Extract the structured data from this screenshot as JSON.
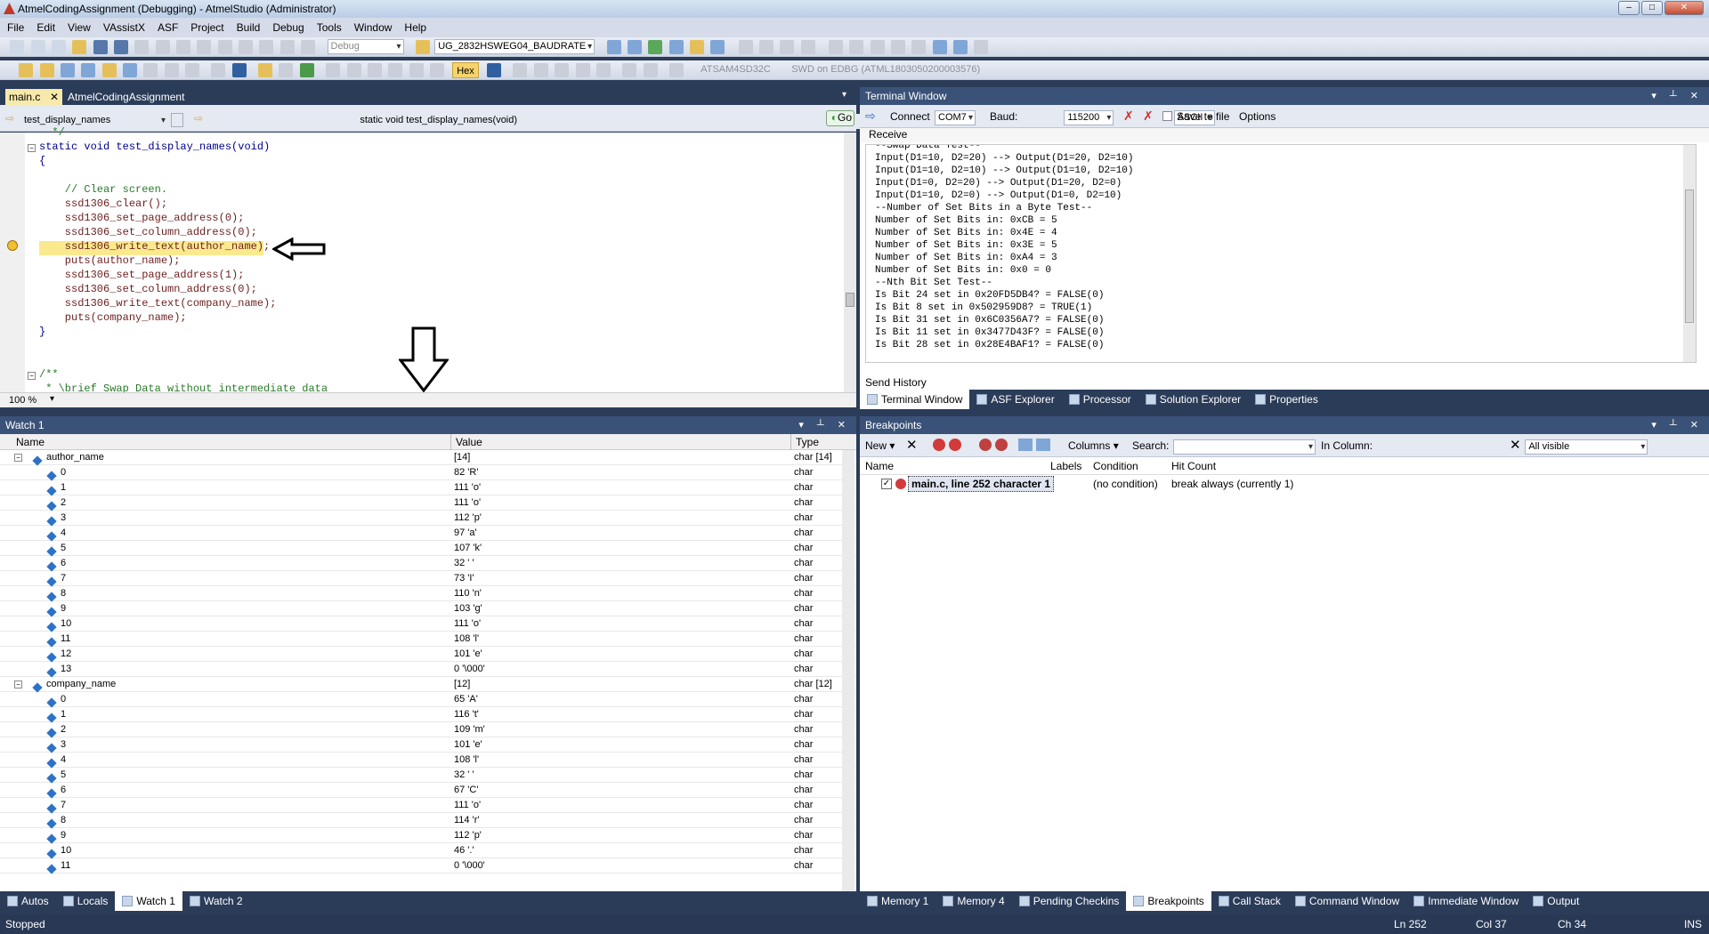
{
  "window": {
    "title": "AtmelCodingAssignment (Debugging) - AtmelStudio (Administrator)"
  },
  "menu": [
    "File",
    "Edit",
    "View",
    "VAssistX",
    "ASF",
    "Project",
    "Build",
    "Debug",
    "Tools",
    "Window",
    "Help"
  ],
  "toolbar": {
    "config": "Debug",
    "target_combo": "UG_2832HSWEG04_BAUDRATE",
    "hex_label": "Hex",
    "device": "ATSAM4SD32C",
    "tool": "SWD on EDBG (ATML1803050200003576)"
  },
  "editor": {
    "tabs": [
      "main.c",
      "AtmelCodingAssignment"
    ],
    "scope_combo": "test_display_names",
    "func_combo": "static void test_display_names(void)",
    "go_label": "Go",
    "zoom": "100 %",
    "lines": [
      "  */",
      "static void test_display_names(void)",
      "{",
      "",
      "    // Clear screen.",
      "    ssd1306_clear();",
      "    ssd1306_set_page_address(0);",
      "    ssd1306_set_column_address(0);",
      "    ssd1306_write_text(author_name);",
      "    puts(author_name);",
      "    ssd1306_set_page_address(1);",
      "    ssd1306_set_column_address(0);",
      "    ssd1306_write_text(company_name);",
      "    puts(company_name);",
      "}",
      "",
      "",
      "/**",
      " * \\brief Swap Data without intermediate data"
    ]
  },
  "terminal": {
    "title": "Terminal Window",
    "connect": "Connect",
    "port": "COM7",
    "baud_label": "Baud:",
    "baud": "115200",
    "mode": "ASCII",
    "save_label": "Save to file",
    "options": "Options",
    "receive": "Receive",
    "send_history": "Send History",
    "lines": [
      "--Swap Data Test--",
      "Input(D1=10, D2=20) --> Output(D1=20, D2=10)",
      "Input(D1=10, D2=10) --> Output(D1=10, D2=10)",
      "Input(D1=0, D2=20) --> Output(D1=20, D2=0)",
      "Input(D1=10, D2=0) --> Output(D1=0, D2=10)",
      "--Number of Set Bits in a Byte Test--",
      "Number of Set Bits in: 0xCB = 5",
      "Number of Set Bits in: 0x4E = 4",
      "Number of Set Bits in: 0x3E = 5",
      "Number of Set Bits in: 0xA4 = 3",
      "Number of Set Bits in: 0x0 = 0",
      "--Nth Bit Set Test--",
      "Is Bit 24 set in 0x20FD5DB4? = FALSE(0)",
      "Is Bit 8 set in 0x502959D8? = TRUE(1)",
      "Is Bit 31 set in 0x6C0356A7? = FALSE(0)",
      "Is Bit 11 set in 0x3477D43F? = FALSE(0)",
      "Is Bit 28 set in 0x28E4BAF1? = FALSE(0)"
    ],
    "tabs": [
      "Terminal Window",
      "ASF Explorer",
      "Processor",
      "Solution Explorer",
      "Properties"
    ]
  },
  "watch": {
    "title": "Watch 1",
    "headers": [
      "Name",
      "Value",
      "Type"
    ],
    "groups": [
      {
        "name": "author_name",
        "value": "[14]",
        "type": "char [14]",
        "items": [
          [
            "0",
            "82 'R'"
          ],
          [
            "1",
            "111 'o'"
          ],
          [
            "2",
            "111 'o'"
          ],
          [
            "3",
            "112 'p'"
          ],
          [
            "4",
            "97 'a'"
          ],
          [
            "5",
            "107 'k'"
          ],
          [
            "6",
            "32 ' '"
          ],
          [
            "7",
            "73 'I'"
          ],
          [
            "8",
            "110 'n'"
          ],
          [
            "9",
            "103 'g'"
          ],
          [
            "10",
            "111 'o'"
          ],
          [
            "11",
            "108 'l'"
          ],
          [
            "12",
            "101 'e'"
          ],
          [
            "13",
            "0 '\\000'"
          ]
        ]
      },
      {
        "name": "company_name",
        "value": "[12]",
        "type": "char [12]",
        "items": [
          [
            "0",
            "65 'A'"
          ],
          [
            "1",
            "116 't'"
          ],
          [
            "2",
            "109 'm'"
          ],
          [
            "3",
            "101 'e'"
          ],
          [
            "4",
            "108 'l'"
          ],
          [
            "5",
            "32 ' '"
          ],
          [
            "6",
            "67 'C'"
          ],
          [
            "7",
            "111 'o'"
          ],
          [
            "8",
            "114 'r'"
          ],
          [
            "9",
            "112 'p'"
          ],
          [
            "10",
            "46 '.'"
          ],
          [
            "11",
            "0 '\\000'"
          ]
        ]
      }
    ],
    "item_type": "char"
  },
  "breakpoints": {
    "title": "Breakpoints",
    "new": "New",
    "columns": "Columns",
    "search_label": "Search:",
    "in_column_label": "In Column:",
    "in_column": "All visible",
    "headers": [
      "Name",
      "Labels",
      "Condition",
      "Hit Count"
    ],
    "row": {
      "name": "main.c, line 252 character 1",
      "condition": "(no condition)",
      "hit": "break always (currently 1)"
    }
  },
  "bottom_tabs_left": [
    "Autos",
    "Locals",
    "Watch 1",
    "Watch 2"
  ],
  "bottom_tabs_right": [
    "Memory 1",
    "Memory 4",
    "Pending Checkins",
    "Breakpoints",
    "Call Stack",
    "Command Window",
    "Immediate Window",
    "Output"
  ],
  "status": {
    "text": "Stopped",
    "ln": "Ln 252",
    "col": "Col 37",
    "ch": "Ch 34",
    "ins": "INS"
  }
}
